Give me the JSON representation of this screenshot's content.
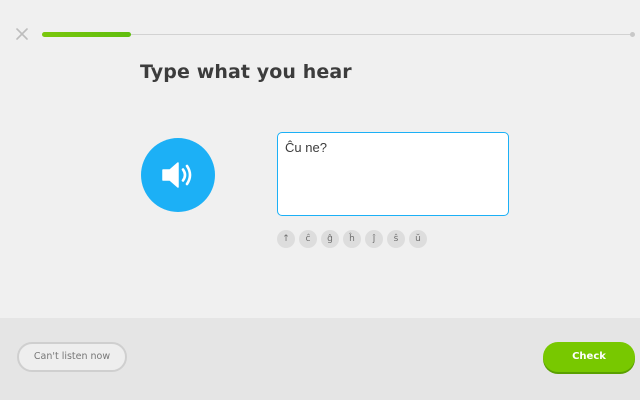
{
  "header": {
    "close_icon": "close-icon",
    "progress": 0.15
  },
  "prompt": {
    "title": "Type what you hear"
  },
  "audio": {
    "icon": "speaker-icon"
  },
  "answer": {
    "value": "Ĉu ne?"
  },
  "special_chars": [
    "↑",
    "ĉ",
    "ĝ",
    "ĥ",
    "ĵ",
    "ŝ",
    "ŭ"
  ],
  "footer": {
    "cant_listen_label": "Can't listen now",
    "check_label": "Check"
  },
  "colors": {
    "accent_blue": "#1cb0f6",
    "progress_green": "#78c800",
    "check_green": "#78c800"
  }
}
